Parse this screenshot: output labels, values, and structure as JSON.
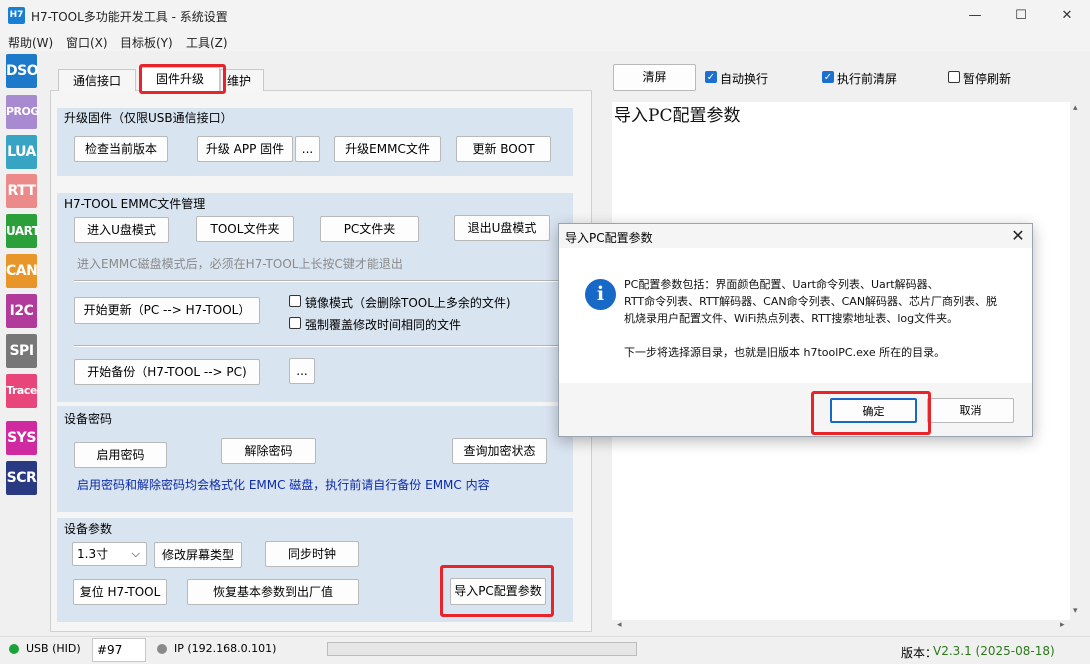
{
  "window": {
    "app_icon_text": "H7",
    "title": "H7-TOOL多功能开发工具 - 系统设置",
    "minimize": "—",
    "maximize": "☐",
    "close": "✕"
  },
  "menu": [
    "帮助(W)",
    "窗口(X)",
    "目标板(Y)",
    "工具(Z)"
  ],
  "sidebar": [
    {
      "label": "DSO",
      "color": "#1d79c9"
    },
    {
      "label": "PROG",
      "color": "#a78ad0"
    },
    {
      "label": "LUA",
      "color": "#37a4c3"
    },
    {
      "label": "RTT",
      "color": "#ec8a8a"
    },
    {
      "label": "UART",
      "color": "#2a9f3a"
    },
    {
      "label": "CAN",
      "color": "#e8962a"
    },
    {
      "label": "I2C",
      "color": "#b13a9a"
    },
    {
      "label": "SPI",
      "color": "#777777"
    },
    {
      "label": "Trace",
      "color": "#e8457a"
    },
    {
      "label": "SYS",
      "color": "#cf2aa0"
    },
    {
      "label": "SCR",
      "color": "#2a3a82"
    }
  ],
  "tabs": {
    "comm": "通信接口",
    "firmware": "固件升级",
    "maint": "维护"
  },
  "upgrade": {
    "title": "升级固件（仅限USB通信接口）",
    "check_version": "检查当前版本",
    "upgrade_app": "升级 APP 固件",
    "browse": "...",
    "upgrade_emmc": "升级EMMC文件",
    "update_boot": "更新 BOOT"
  },
  "emmc": {
    "title": "H7-TOOL EMMC文件管理",
    "enter_udisk": "进入U盘模式",
    "tool_folder": "TOOL文件夹",
    "pc_folder": "PC文件夹",
    "exit_udisk": "退出U盘模式",
    "hint": "进入EMMC磁盘模式后，必须在H7-TOOL上长按C键才能退出",
    "start_update": "开始更新（PC --> H7-TOOL）",
    "mirror_mode": "镜像模式（会删除TOOL上多余的文件)",
    "force_overwrite": "强制覆盖修改时间相同的文件",
    "start_backup": "开始备份（H7-TOOL --> PC)",
    "browse": "..."
  },
  "password": {
    "title": "设备密码",
    "enable": "启用密码",
    "disable": "解除密码",
    "query": "查询加密状态",
    "hint": "启用密码和解除密码均会格式化 EMMC 磁盘，执行前请自行备份 EMMC 内容"
  },
  "params": {
    "title": "设备参数",
    "screen_size": "1.3寸",
    "dropdown_arrow": "⌵",
    "change_screen": "修改屏幕类型",
    "sync_clock": "同步时钟",
    "reset": "复位 H7-TOOL",
    "restore": "恢复基本参数到出厂值",
    "import_pc": "导入PC配置参数"
  },
  "output": {
    "clear": "清屏",
    "auto_wrap": "自动换行",
    "clear_before": "执行前清屏",
    "pause": "暂停刷新",
    "check_mark": "✓",
    "text": "导入PC配置参数",
    "scroll_up": "▴",
    "scroll_down": "▾",
    "scroll_left": "◂",
    "scroll_right": "▸"
  },
  "dialog": {
    "title": "导入PC配置参数",
    "close": "✕",
    "icon": "i",
    "line1": "PC配置参数包括：界面颜色配置、Uart命令列表、Uart解码器、",
    "line2": "RTT命令列表、RTT解码器、CAN命令列表、CAN解码器、芯片厂商列表、脱",
    "line3": "机烧录用户配置文件、WiFi热点列表、RTT搜索地址表、log文件夹。",
    "line4": "下一步将选择源目录，也就是旧版本 h7toolPC.exe 所在的目录。",
    "ok": "确定",
    "cancel": "取消"
  },
  "status": {
    "usb": "USB (HID)",
    "port": "#97",
    "ip": "IP (192.168.0.101)",
    "version_label": "版本：",
    "version": "V2.3.1 (2025-08-18)",
    "usb_color": "#1aa33a",
    "ip_color": "#8a8a8a"
  }
}
